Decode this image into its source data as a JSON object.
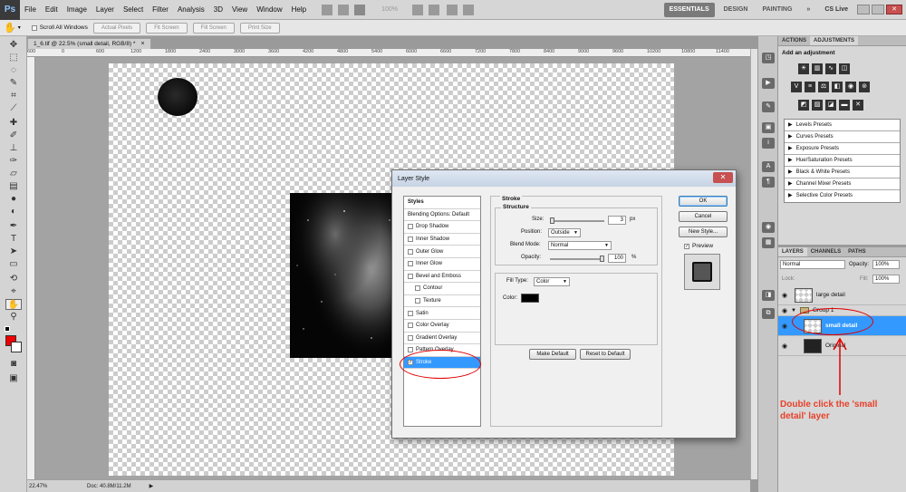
{
  "app": {
    "logo": "Ps"
  },
  "menu": [
    "File",
    "Edit",
    "Image",
    "Layer",
    "Select",
    "Filter",
    "Analysis",
    "3D",
    "View",
    "Window",
    "Help"
  ],
  "zoom_menu": "100%",
  "workspaces": [
    "ESSENTIALS",
    "DESIGN",
    "PAINTING",
    "»"
  ],
  "cslive": "CS Live",
  "options": {
    "scroll_all": "Scroll All Windows",
    "actual_pixels": "Actual Pixels",
    "fit_screen": "Fit Screen",
    "fill_screen": "Fill Screen",
    "print_size": "Print Size"
  },
  "document": {
    "tab": "1_6.tif @ 22.5% (small detail, RGB/8) *",
    "close": "×"
  },
  "ruler_marks": [
    "600",
    "0",
    "600",
    "1200",
    "1800",
    "2400",
    "3000",
    "3600",
    "4200",
    "4800",
    "5400",
    "6000",
    "6600",
    "7200",
    "7800",
    "8400",
    "9000",
    "9600",
    "10200",
    "10800",
    "11400"
  ],
  "status": {
    "zoom": "22.47%",
    "doc": "Doc: 40.8M/11.2M"
  },
  "panels": {
    "top_tabs": [
      "ACTIONS",
      "ADJUSTMENTS"
    ],
    "adj_title": "Add an adjustment",
    "presets": [
      "Levels Presets",
      "Curves Presets",
      "Exposure Presets",
      "Hue/Saturation Presets",
      "Black & White Presets",
      "Channel Mixer Presets",
      "Selective Color Presets"
    ],
    "layer_tabs": [
      "LAYERS",
      "CHANNELS",
      "PATHS"
    ],
    "blend": "Normal",
    "opacity_label": "Opacity:",
    "opacity": "100%",
    "lock_label": "Lock:",
    "fill_label": "Fill:",
    "fill": "100%",
    "layers": [
      {
        "name": "large detail"
      },
      {
        "name": "Group 1"
      },
      {
        "name": "small detail"
      },
      {
        "name": "Original"
      }
    ]
  },
  "dialog": {
    "title": "Layer Style",
    "close": "✕",
    "styles": [
      {
        "label": "Styles",
        "checkbox": false,
        "checked": false
      },
      {
        "label": "Blending Options: Default",
        "checkbox": false,
        "checked": false
      },
      {
        "label": "Drop Shadow",
        "checkbox": true,
        "checked": false
      },
      {
        "label": "Inner Shadow",
        "checkbox": true,
        "checked": false
      },
      {
        "label": "Outer Glow",
        "checkbox": true,
        "checked": false
      },
      {
        "label": "Inner Glow",
        "checkbox": true,
        "checked": false
      },
      {
        "label": "Bevel and Emboss",
        "checkbox": true,
        "checked": false
      },
      {
        "label": "Contour",
        "checkbox": true,
        "checked": false
      },
      {
        "label": "Texture",
        "checkbox": true,
        "checked": false
      },
      {
        "label": "Satin",
        "checkbox": true,
        "checked": false
      },
      {
        "label": "Color Overlay",
        "checkbox": true,
        "checked": false
      },
      {
        "label": "Gradient Overlay",
        "checkbox": true,
        "checked": false
      },
      {
        "label": "Pattern Overlay",
        "checkbox": true,
        "checked": false
      },
      {
        "label": "Stroke",
        "checkbox": true,
        "checked": true
      }
    ],
    "stroke": {
      "heading": "Stroke",
      "structure": "Structure",
      "size_label": "Size:",
      "size": "3",
      "size_unit": "px",
      "position_label": "Position:",
      "position": "Outside",
      "blend_label": "Blend Mode:",
      "blend": "Normal",
      "opacity_label": "Opacity:",
      "opacity": "100",
      "opacity_unit": "%",
      "filltype_label": "Fill Type:",
      "filltype": "Color",
      "color_label": "Color:",
      "color": "#000000"
    },
    "buttons": {
      "ok": "OK",
      "cancel": "Cancel",
      "new_style": "New Style...",
      "preview": "Preview",
      "make_default": "Make Default",
      "reset_default": "Reset to Default"
    }
  },
  "annotation": "Double click the 'small detail' layer",
  "colors": {
    "accent": "#3399ff",
    "annotation": "#e8402a",
    "foreground": "#ee0000",
    "background": "#ffffff"
  }
}
